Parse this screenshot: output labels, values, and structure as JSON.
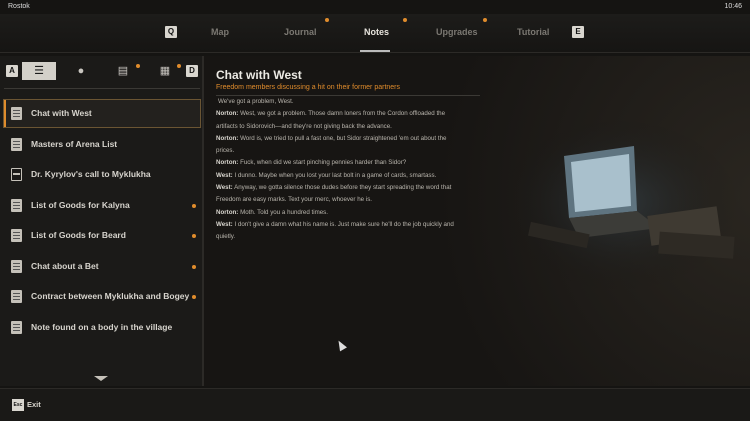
{
  "statusbar": {
    "carrier": "Rostok",
    "time": "10:46"
  },
  "nav": {
    "key_left": "Q",
    "key_right": "E",
    "tabs": [
      {
        "label": "Map",
        "active": false,
        "dot": false
      },
      {
        "label": "Journal",
        "active": false,
        "dot": true
      },
      {
        "label": "Notes",
        "active": true,
        "dot": true
      },
      {
        "label": "Upgrades",
        "active": false,
        "dot": true
      },
      {
        "label": "Tutorial",
        "active": false,
        "dot": false
      }
    ]
  },
  "filters": {
    "key_left": "A",
    "key_right": "D",
    "buttons": [
      {
        "icon": "list-icon",
        "active": true
      },
      {
        "icon": "exclamation-icon",
        "active": false
      },
      {
        "icon": "note-icon",
        "active": false,
        "dot": true
      },
      {
        "icon": "map-note-icon",
        "active": false,
        "dot": true
      }
    ]
  },
  "notes": [
    {
      "label": "Chat with West",
      "icon": "document-icon",
      "active": true,
      "dot": false
    },
    {
      "label": "Masters of Arena List",
      "icon": "document-icon",
      "active": false,
      "dot": false
    },
    {
      "label": "Dr. Kyrylov's call to Myklukha",
      "icon": "audio-icon",
      "active": false,
      "dot": false
    },
    {
      "label": "List of Goods for Kalyna",
      "icon": "document-icon",
      "active": false,
      "dot": true
    },
    {
      "label": "List of Goods for Beard",
      "icon": "document-icon",
      "active": false,
      "dot": true
    },
    {
      "label": "Chat about a Bet",
      "icon": "document-icon",
      "active": false,
      "dot": true
    },
    {
      "label": "Contract between Myklukha and Bogey",
      "icon": "document-icon",
      "active": false,
      "dot": true
    },
    {
      "label": "Note found on a body in the village",
      "icon": "document-icon",
      "active": false,
      "dot": false
    }
  ],
  "note": {
    "title": "Chat with West",
    "subtitle": "Freedom members discussing a hit on their former partners",
    "intro": "We've got a problem, West.",
    "lines": [
      {
        "speaker": "Norton:",
        "text": " West, we got a problem. Those damn loners from the Cordon offloaded the artifacts to Sidorovich—and they're not giving back the advance."
      },
      {
        "speaker": "Norton:",
        "text": " Word is, we tried to pull a fast one, but Sidor straightened 'em out about the prices."
      },
      {
        "speaker": "Norton:",
        "text": " Fuck, when did we start pinching pennies harder than Sidor?"
      },
      {
        "speaker": "West:",
        "text": " I dunno. Maybe when you lost your last bolt in a game of cards, smartass."
      },
      {
        "speaker": "West:",
        "text": " Anyway, we gotta silence those dudes before they start spreading the word that Freedom are easy marks. Text your merc, whoever he is."
      },
      {
        "speaker": "Norton:",
        "text": " Moth. Told you a hundred times."
      },
      {
        "speaker": "West:",
        "text": " I don't give a damn what his name is. Just make sure he'll do the job quickly and quietly."
      }
    ]
  },
  "footer": {
    "key": "Esc",
    "label": "Exit"
  },
  "colors": {
    "accent": "#e08c2c",
    "background": "#151412",
    "text": "#d9d6cf"
  }
}
